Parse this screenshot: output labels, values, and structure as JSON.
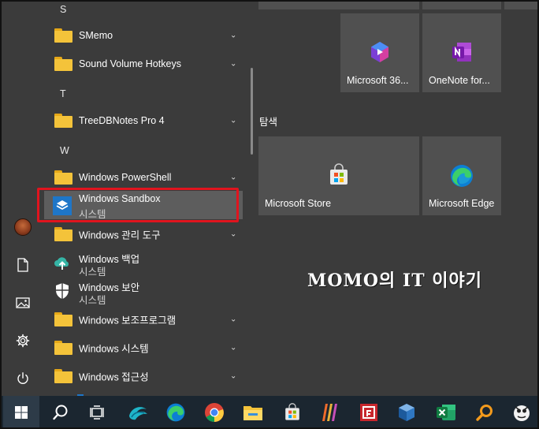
{
  "app_list": {
    "letters": {
      "s": "S",
      "t": "T",
      "w": "W"
    },
    "items": [
      {
        "label": "SMemo",
        "kind": "folder",
        "expand": "⌄"
      },
      {
        "label": "Sound Volume Hotkeys",
        "kind": "folder",
        "expand": "⌄"
      },
      {
        "label": "TreeDBNotes Pro 4",
        "kind": "folder",
        "expand": "⌄"
      },
      {
        "label": "Windows PowerShell",
        "kind": "folder",
        "expand": "⌄"
      },
      {
        "label": "Windows Sandbox",
        "sub": "시스템",
        "kind": "app",
        "highlighted": true
      },
      {
        "label": "Windows 관리 도구",
        "kind": "folder",
        "expand": "⌄"
      },
      {
        "label": "Windows 백업",
        "sub": "시스템",
        "kind": "app"
      },
      {
        "label": "Windows 보안",
        "sub": "시스템",
        "kind": "app"
      },
      {
        "label": "Windows 보조프로그램",
        "kind": "folder",
        "expand": "⌄"
      },
      {
        "label": "Windows 시스템",
        "kind": "folder",
        "expand": "⌄"
      },
      {
        "label": "Windows 접근성",
        "kind": "folder",
        "expand": "⌄"
      }
    ]
  },
  "tiles": {
    "top": [
      {
        "label": "Microsoft 36...",
        "icon": "microsoft-365-icon"
      },
      {
        "label": "OneNote for...",
        "icon": "onenote-icon"
      }
    ],
    "section_title": "탐색",
    "section": [
      {
        "label": "Microsoft Store",
        "icon": "store-icon"
      },
      {
        "label": "Microsoft Edge",
        "icon": "edge-icon"
      }
    ]
  },
  "watermark": "MOMO의 IT 이야기",
  "colors": {
    "highlight_border": "#e0141e",
    "tile_bg": "#505050",
    "taskbar_bg": "#1b2630",
    "folder": "#f4c33a"
  },
  "taskbar": [
    "start-icon",
    "search-icon",
    "task-view-icon",
    "app-icon",
    "edge-icon",
    "chrome-icon",
    "file-explorer-icon",
    "store-icon",
    "app-icon",
    "app-icon",
    "virtualbox-icon",
    "excel-icon",
    "search-app-icon",
    "app-icon"
  ]
}
